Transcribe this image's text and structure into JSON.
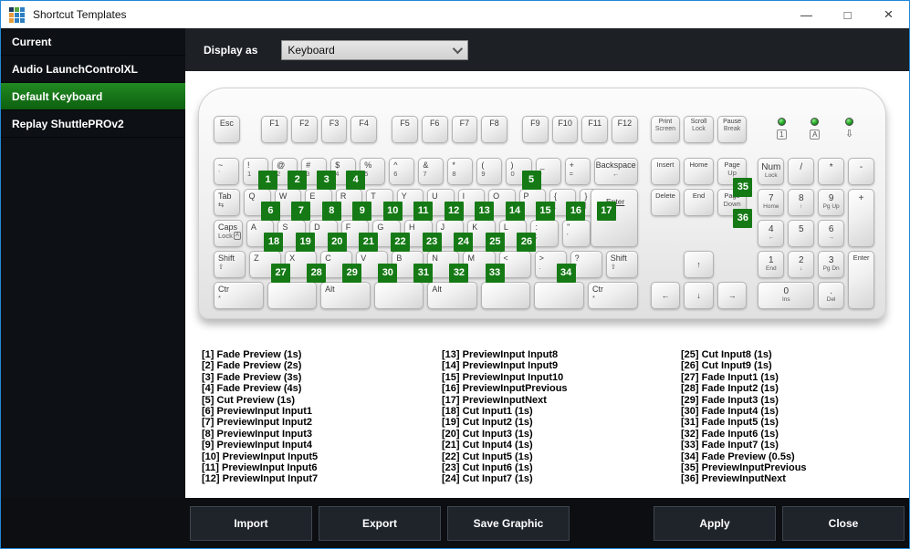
{
  "window": {
    "title": "Shortcut Templates",
    "controls": {
      "minimize": "—",
      "maximize": "□",
      "close": "×"
    },
    "app_icon_colors": [
      "#1b3a5c",
      "#53a63e",
      "#2d7fc1",
      "#e89b3c",
      "#2d7fc1",
      "#2d7fc1",
      "#e89b3c",
      "#2d7fc1",
      "#2d7fc1"
    ],
    "border_color": "#2287d8"
  },
  "sidebar": {
    "items": [
      {
        "label": "Current",
        "selected": false
      },
      {
        "label": "Audio LaunchControlXL",
        "selected": false
      },
      {
        "label": "Default Keyboard",
        "selected": true
      },
      {
        "label": "Replay ShuttlePROv2",
        "selected": false
      }
    ],
    "selected_color": "#1a7e1a"
  },
  "header": {
    "display_as_label": "Display as",
    "dropdown_value": "Keyboard"
  },
  "keyboard": {
    "badge_color": "#157a15",
    "main": {
      "frow": [
        {
          "l": "Esc"
        },
        {
          "gap": 0.8
        },
        {
          "l": "F1"
        },
        {
          "l": "F2"
        },
        {
          "l": "F3"
        },
        {
          "l": "F4"
        },
        {
          "gap": 0.5
        },
        {
          "l": "F5"
        },
        {
          "l": "F6"
        },
        {
          "l": "F7"
        },
        {
          "l": "F8"
        },
        {
          "gap": 0.5
        },
        {
          "l": "F9"
        },
        {
          "l": "F10"
        },
        {
          "l": "F11"
        },
        {
          "l": "F12"
        }
      ],
      "rows": [
        [
          {
            "l": "~",
            "s": "`"
          },
          {
            "l": "!",
            "s": "1",
            "b": "1"
          },
          {
            "l": "@",
            "s": "2",
            "b": "2"
          },
          {
            "l": "#",
            "s": "3",
            "b": "3"
          },
          {
            "l": "$",
            "s": "4",
            "b": "4"
          },
          {
            "l": "%",
            "s": "5"
          },
          {
            "l": "^",
            "s": "6"
          },
          {
            "l": "&",
            "s": "7"
          },
          {
            "l": "*",
            "s": "8"
          },
          {
            "l": "(",
            "s": "9"
          },
          {
            "l": ")",
            "s": "0",
            "b": "5"
          },
          {
            "l": "_",
            "s": "-"
          },
          {
            "l": "+",
            "s": "="
          },
          {
            "l": "Backspace",
            "s": "←",
            "u": 2,
            "cls": "cen"
          }
        ],
        [
          {
            "l": "Tab",
            "s": "⇆",
            "u": 1.5
          },
          {
            "l": "Q",
            "b": "6"
          },
          {
            "l": "W",
            "b": "7"
          },
          {
            "l": "E",
            "b": "8"
          },
          {
            "l": "R",
            "b": "9"
          },
          {
            "l": "T",
            "b": "10"
          },
          {
            "l": "Y",
            "b": "11"
          },
          {
            "l": "U",
            "b": "12"
          },
          {
            "l": "I",
            "b": "13"
          },
          {
            "l": "O",
            "b": "14"
          },
          {
            "l": "P",
            "b": "15"
          },
          {
            "l": "{",
            "s": "[",
            "b": "16"
          },
          {
            "l": "}",
            "s": "]",
            "b": "17"
          },
          {
            "spacer": 1.5
          }
        ],
        [
          {
            "l": "Caps",
            "s": "Lock",
            "box": "A",
            "u": 1.8
          },
          {
            "l": "A",
            "b": "18"
          },
          {
            "l": "S",
            "b": "19"
          },
          {
            "l": "D",
            "b": "20"
          },
          {
            "l": "F",
            "b": "21"
          },
          {
            "l": "G",
            "b": "22"
          },
          {
            "l": "H",
            "b": "23"
          },
          {
            "l": "J",
            "b": "24"
          },
          {
            "l": "K",
            "b": "25"
          },
          {
            "l": "L",
            "b": "26"
          },
          {
            "l": ":",
            "s": ";"
          },
          {
            "l": "\"",
            "s": "'"
          },
          {
            "spacer": 2.2
          }
        ],
        [
          {
            "l": "Shift",
            "s": "⇧",
            "u": 2.2
          },
          {
            "l": "Z",
            "b": "27"
          },
          {
            "l": "X",
            "b": "28"
          },
          {
            "l": "C",
            "b": "29"
          },
          {
            "l": "V",
            "b": "30"
          },
          {
            "l": "B",
            "b": "31"
          },
          {
            "l": "N",
            "b": "32"
          },
          {
            "l": "M",
            "b": "33"
          },
          {
            "l": "<",
            "s": ","
          },
          {
            "l": ">",
            "s": ".",
            "b": "34"
          },
          {
            "l": "?",
            "s": "/"
          },
          {
            "l": "Shift",
            "s": "⇧",
            "u": 2.8
          }
        ],
        [
          {
            "l": "Ctr",
            "s": "*",
            "u": 1.3
          },
          {
            "u": 1.2
          },
          {
            "l": "Alt",
            "u": 1.2
          },
          {
            "u": 6.3
          },
          {
            "l": "Alt",
            "u": 1.2
          },
          {
            "u": 1.1
          },
          {
            "u": 1.1
          },
          {
            "l": "Ctr",
            "s": "*",
            "u": 1.6
          }
        ]
      ],
      "enter": {
        "l": "Enter"
      }
    },
    "nav": {
      "frow": [
        {
          "l": "Print",
          "s": "Screen"
        },
        {
          "l": "Scroll",
          "s": "Lock"
        },
        {
          "l": "Pause",
          "s": "Break"
        }
      ],
      "keys": [
        {
          "l": "Insert",
          "r": 1,
          "c": 1
        },
        {
          "l": "Home",
          "r": 1,
          "c": 2
        },
        {
          "l": "Page",
          "s": "Up",
          "r": 1,
          "c": 3,
          "b": "35",
          "bb": true
        },
        {
          "l": "Delete",
          "r": 2,
          "c": 1
        },
        {
          "l": "End",
          "r": 2,
          "c": 2
        },
        {
          "l": "Page",
          "s": "Down",
          "r": 2,
          "c": 3,
          "b": "36",
          "bb": true
        },
        {
          "l": "↑",
          "r": 4,
          "c": 2,
          "cls": "arrow"
        },
        {
          "l": "←",
          "r": 5,
          "c": 1,
          "cls": "arrow"
        },
        {
          "l": "↓",
          "r": 5,
          "c": 2,
          "cls": "arrow"
        },
        {
          "l": "→",
          "r": 5,
          "c": 3,
          "cls": "arrow"
        }
      ]
    },
    "numpad": {
      "leds": [
        {
          "symbol": "1",
          "boxed": true
        },
        {
          "symbol": "A",
          "boxed": true
        },
        {
          "symbol": "⇩",
          "boxed": false
        }
      ],
      "keys": [
        {
          "l": "Num",
          "s": "Lock",
          "r": 1,
          "c": 1,
          "cls": "np"
        },
        {
          "l": "/",
          "r": 1,
          "c": 2,
          "cls": "np"
        },
        {
          "l": "*",
          "r": 1,
          "c": 3,
          "cls": "np"
        },
        {
          "l": "-",
          "r": 1,
          "c": 4,
          "cls": "np"
        },
        {
          "l": "7",
          "s": "Home",
          "r": 2,
          "c": 1,
          "cls": "np"
        },
        {
          "l": "8",
          "s": "↑",
          "r": 2,
          "c": 2,
          "cls": "np"
        },
        {
          "l": "9",
          "s": "Pg Up",
          "r": 2,
          "c": 3,
          "cls": "np"
        },
        {
          "l": "+",
          "r": 2,
          "c": 4,
          "rs": 2,
          "cls": "np"
        },
        {
          "l": "4",
          "s": "←",
          "r": 3,
          "c": 1,
          "cls": "np"
        },
        {
          "l": "5",
          "r": 3,
          "c": 2,
          "cls": "np"
        },
        {
          "l": "6",
          "s": "→",
          "r": 3,
          "c": 3,
          "cls": "np"
        },
        {
          "l": "1",
          "s": "End",
          "r": 4,
          "c": 1,
          "cls": "np"
        },
        {
          "l": "2",
          "s": "↓",
          "r": 4,
          "c": 2,
          "cls": "np"
        },
        {
          "l": "3",
          "s": "Pg Dn",
          "r": 4,
          "c": 3,
          "cls": "np"
        },
        {
          "l": "Enter",
          "r": 4,
          "c": 4,
          "rs": 2,
          "cls": "cen small"
        },
        {
          "l": "0",
          "s": "Ins",
          "r": 5,
          "c": 1,
          "cs": 2,
          "cls": "np"
        },
        {
          "l": ".",
          "s": "Del",
          "r": 5,
          "c": 3,
          "cls": "np"
        }
      ]
    }
  },
  "legend": {
    "columns": [
      [
        "[1] Fade Preview (1s)",
        "[2] Fade Preview (2s)",
        "[3] Fade Preview (3s)",
        "[4] Fade Preview (4s)",
        "[5] Cut Preview (1s)",
        "[6] PreviewInput Input1",
        "[7] PreviewInput Input2",
        "[8] PreviewInput Input3",
        "[9] PreviewInput Input4",
        "[10] PreviewInput Input5",
        "[11] PreviewInput Input6",
        "[12] PreviewInput Input7"
      ],
      [
        "[13] PreviewInput Input8",
        "[14] PreviewInput Input9",
        "[15] PreviewInput Input10",
        "[16] PreviewInputPrevious",
        "[17] PreviewInputNext",
        "[18] Cut Input1 (1s)",
        "[19] Cut Input2 (1s)",
        "[20] Cut Input3 (1s)",
        "[21] Cut Input4 (1s)",
        "[22] Cut Input5 (1s)",
        "[23] Cut Input6 (1s)",
        "[24] Cut Input7 (1s)"
      ],
      [
        "[25] Cut Input8 (1s)",
        "[26] Cut Input9 (1s)",
        "[27] Fade Input1 (1s)",
        "[28] Fade Input2 (1s)",
        "[29] Fade Input3 (1s)",
        "[30] Fade Input4 (1s)",
        "[31] Fade Input5 (1s)",
        "[32] Fade Input6 (1s)",
        "[33] Fade Input7 (1s)",
        "[34] Fade Preview (0.5s)",
        "[35] PreviewInputPrevious",
        "[36] PreviewInputNext"
      ]
    ]
  },
  "footer": {
    "import_label": "Import",
    "export_label": "Export",
    "save_graphic_label": "Save Graphic",
    "apply_label": "Apply",
    "close_label": "Close"
  }
}
